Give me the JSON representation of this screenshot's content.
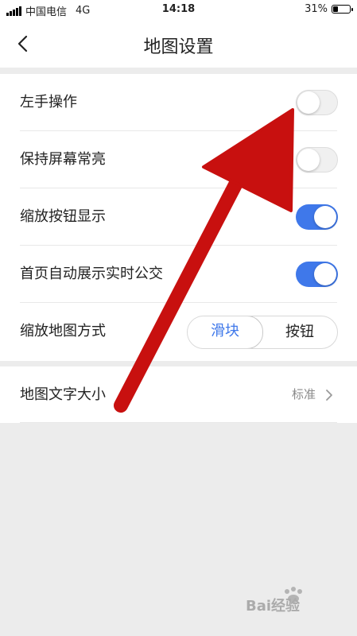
{
  "status_bar": {
    "carrier": "中国电信",
    "network": "4G",
    "time": "14:18",
    "battery_percent": "31%",
    "battery_level": 0.31
  },
  "header": {
    "title": "地图设置",
    "back_icon": "chevron-left-icon"
  },
  "settings": [
    {
      "label": "左手操作",
      "type": "switch",
      "on": false
    },
    {
      "label": "保持屏幕常亮",
      "type": "switch",
      "on": false
    },
    {
      "label": "缩放按钮显示",
      "type": "switch",
      "on": true
    },
    {
      "label": "首页自动展示实时公交",
      "type": "switch",
      "on": true
    },
    {
      "label": "缩放地图方式",
      "type": "segmented",
      "options": [
        "滑块",
        "按钮"
      ],
      "selected": "滑块"
    }
  ],
  "text_size": {
    "label": "地图文字大小",
    "value": "标准",
    "icon": "chevron-right-icon"
  },
  "colors": {
    "accent": "#3f78ea",
    "annotation_arrow": "#c8100f",
    "background": "#ececec"
  },
  "watermark": {
    "text": "Bai经验",
    "icon": "baidu-paw-icon"
  }
}
